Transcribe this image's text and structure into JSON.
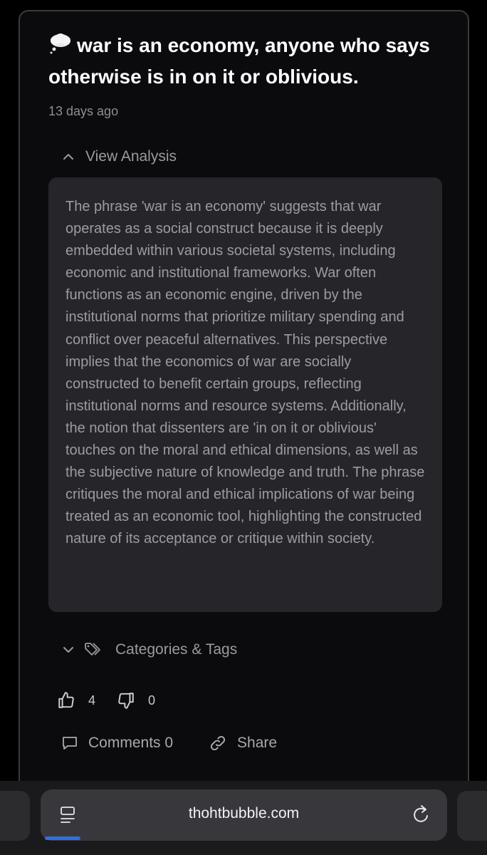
{
  "post": {
    "title": "war is an economy, anyone who says otherwise is in on it or oblivious.",
    "time": "13 days ago"
  },
  "analysis": {
    "toggle_label": "View Analysis",
    "text": "The phrase 'war is an economy' suggests that war operates as a social construct because it is deeply embedded within various societal systems, including economic and institutional frameworks. War often functions as an economic engine, driven by the institutional norms that prioritize military spending and conflict over peaceful alternatives. This perspective implies that the economics of war are socially constructed to benefit certain groups, reflecting institutional norms and resource systems. Additionally, the notion that dissenters are 'in on it or oblivious' touches on the moral and ethical dimensions, as well as the subjective nature of knowledge and truth. The phrase critiques the moral and ethical implications of war being treated as an economic tool, highlighting the constructed nature of its acceptance or critique within society."
  },
  "tags": {
    "toggle_label": "Categories & Tags"
  },
  "votes": {
    "up": "4",
    "down": "0"
  },
  "actions": {
    "comments": "Comments 0",
    "share": "Share"
  },
  "browser": {
    "url": "thohtbubble.com"
  },
  "icons": {
    "title": "thought-bubble-icon",
    "analysis": "chevron-up-icon",
    "tags": [
      "chevron-down-icon",
      "tag-icon"
    ],
    "votes": [
      "thumbs-up-icon",
      "thumbs-down-icon"
    ],
    "actions": [
      "comment-icon",
      "link-icon"
    ],
    "browser": [
      "reader-icon",
      "reload-icon"
    ]
  },
  "colors": {
    "accent": "#2f6fe0",
    "panel": "#26262a",
    "muted_text": "#9b9ba1"
  }
}
